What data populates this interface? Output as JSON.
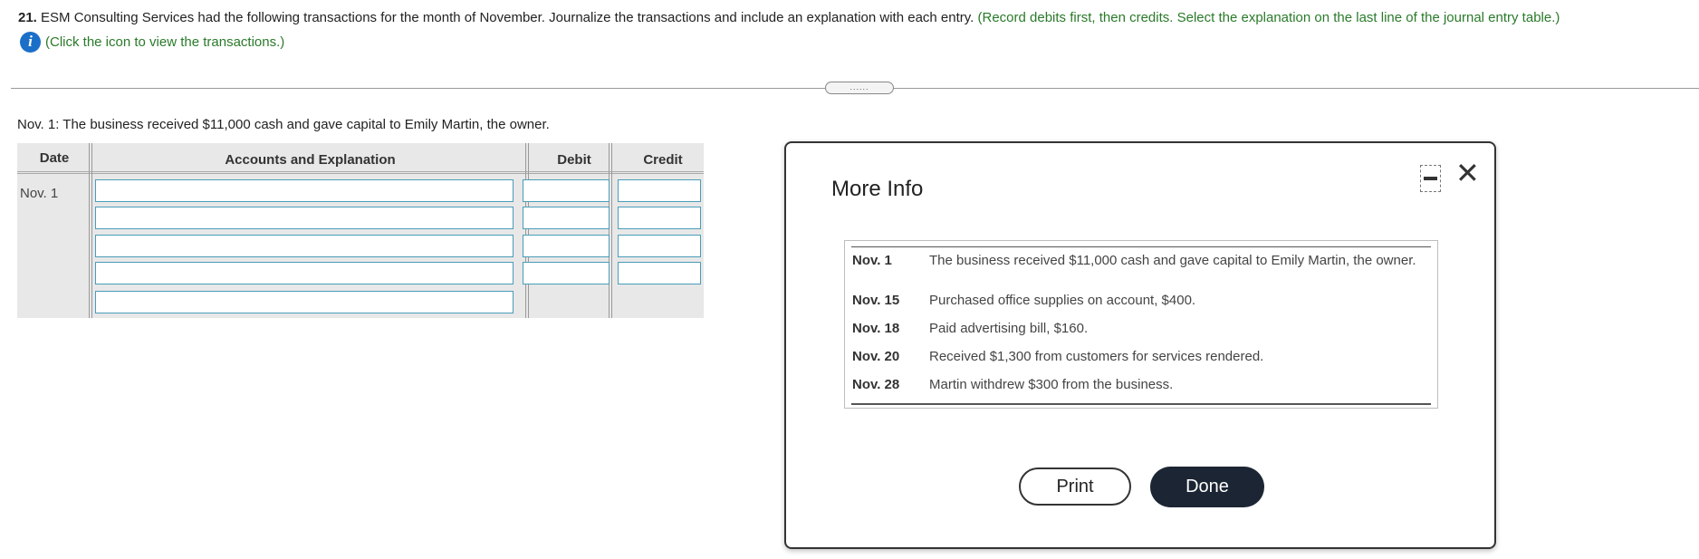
{
  "question": {
    "number": "21.",
    "text": "ESM Consulting Services had the following transactions for the month of November. Journalize the transactions and include an explanation with each entry.",
    "instruction": "(Record debits first, then credits. Select the explanation on the last line of the journal entry table.)",
    "info_link": "(Click the icon to view the transactions.)",
    "info_icon": "info-icon"
  },
  "splitter_label": "......",
  "prompt": "Nov. 1: The business received $11,000 cash and gave capital to Emily Martin, the owner.",
  "journal": {
    "headers": {
      "date": "Date",
      "accounts": "Accounts and Explanation",
      "debit": "Debit",
      "credit": "Credit"
    },
    "date_value": "Nov. 1",
    "entry_rows": 4,
    "explanation_rows": 1
  },
  "modal": {
    "title": "More Info",
    "minimize_icon": "minimize-icon",
    "close_icon": "close-icon",
    "close_glyph": "✕",
    "transactions": [
      {
        "date": "Nov. 1",
        "desc": "The business received $11,000 cash and gave capital to Emily Martin, the owner."
      },
      {
        "date": "Nov. 15",
        "desc": "Purchased office supplies on account, $400."
      },
      {
        "date": "Nov. 18",
        "desc": "Paid advertising bill, $160."
      },
      {
        "date": "Nov. 20",
        "desc": "Received $1,300 from customers for services rendered."
      },
      {
        "date": "Nov. 28",
        "desc": "Martin withdrew $300 from the business."
      }
    ],
    "print_label": "Print",
    "done_label": "Done"
  }
}
